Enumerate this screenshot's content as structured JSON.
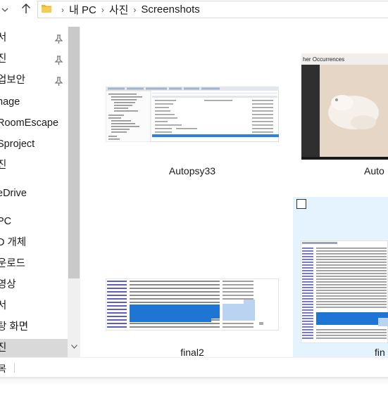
{
  "breadcrumb": {
    "items": [
      "내 PC",
      "사진",
      "Screenshots"
    ],
    "separator": "›"
  },
  "nav_pane": {
    "items": [
      {
        "label": "서",
        "pinned": true
      },
      {
        "label": "진",
        "pinned": true
      },
      {
        "label": "업보안",
        "pinned": true
      },
      {
        "label": "nage",
        "pinned": false
      },
      {
        "label": "RoomEscape",
        "pinned": false
      },
      {
        "label": "Sproject",
        "pinned": false
      },
      {
        "label": "진",
        "pinned": false
      },
      {
        "label": "eDrive",
        "pinned": false
      },
      {
        "label": "PC",
        "pinned": false
      },
      {
        "label": "D 개체",
        "pinned": false
      },
      {
        "label": "운로드",
        "pinned": false
      },
      {
        "label": "영상",
        "pinned": false
      },
      {
        "label": "서",
        "pinned": false
      },
      {
        "label": "탕 화면",
        "pinned": false
      },
      {
        "label": "진",
        "pinned": false,
        "selected": true
      }
    ]
  },
  "files": [
    {
      "name": "Autopsy33"
    },
    {
      "name": "Auto"
    },
    {
      "name": "final2"
    },
    {
      "name": "fin"
    }
  ],
  "thumb_text": {
    "autopsy2_title": "her Occurrences"
  },
  "status": {
    "item_count": "목"
  },
  "colors": {
    "selection_bg": "#cce8ff",
    "nav_selected": "#d9d9d9",
    "hex_highlight": "#1f75d4"
  }
}
